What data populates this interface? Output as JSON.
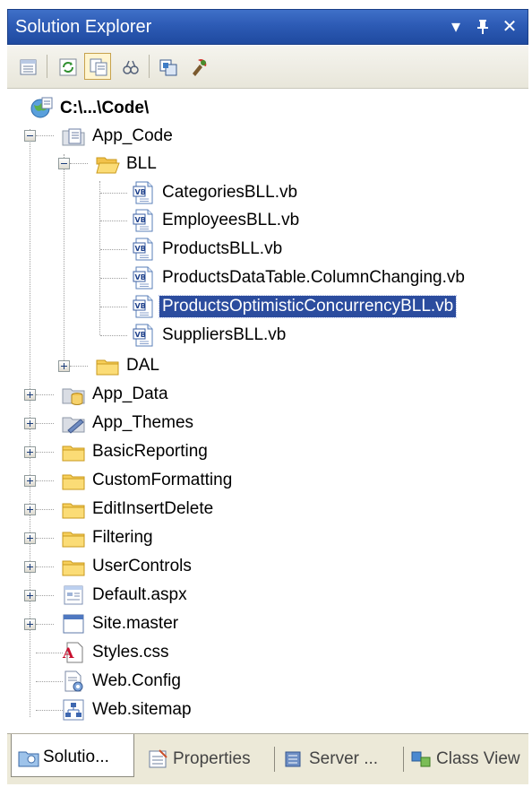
{
  "window": {
    "title": "Solution Explorer",
    "dropdown_glyph": "▾",
    "pin_glyph": "ⵃ",
    "close_glyph": "✕"
  },
  "toolbar": {
    "buttons": [
      {
        "icon": "properties-icon"
      },
      {
        "icon": "refresh-icon"
      },
      {
        "icon": "show-all-files-icon",
        "pressed": true
      },
      {
        "icon": "nest-related-files-icon"
      },
      {
        "icon": "copy-web-site-icon"
      },
      {
        "icon": "asp-net-configuration-icon"
      }
    ]
  },
  "tree": {
    "root": {
      "label": "C:\\...\\Code\\",
      "icon": "web-project-icon"
    },
    "app_code": {
      "label": "App_Code",
      "icon": "special-folder-icon",
      "expanded": true
    },
    "bll": {
      "label": "BLL",
      "icon": "open-folder-icon",
      "expanded": true
    },
    "bll_files": [
      {
        "label": "CategoriesBLL.vb",
        "icon": "vb-file-icon"
      },
      {
        "label": "EmployeesBLL.vb",
        "icon": "vb-file-icon"
      },
      {
        "label": "ProductsBLL.vb",
        "icon": "vb-file-icon"
      },
      {
        "label": "ProductsDataTable.ColumnChanging.vb",
        "icon": "vb-file-icon"
      },
      {
        "label": "ProductsOptimisticConcurrencyBLL.vb",
        "icon": "vb-file-icon",
        "selected": true
      },
      {
        "label": "SuppliersBLL.vb",
        "icon": "vb-file-icon"
      }
    ],
    "dal": {
      "label": "DAL",
      "icon": "folder-icon",
      "expanded": false
    },
    "items": [
      {
        "label": "App_Data",
        "icon": "app-data-folder-icon",
        "expandable": true
      },
      {
        "label": "App_Themes",
        "icon": "app-themes-folder-icon",
        "expandable": true
      },
      {
        "label": "BasicReporting",
        "icon": "folder-icon",
        "expandable": true
      },
      {
        "label": "CustomFormatting",
        "icon": "folder-icon",
        "expandable": true
      },
      {
        "label": "EditInsertDelete",
        "icon": "folder-icon",
        "expandable": true
      },
      {
        "label": "Filtering",
        "icon": "folder-icon",
        "expandable": true
      },
      {
        "label": "UserControls",
        "icon": "folder-icon",
        "expandable": true
      },
      {
        "label": "Default.aspx",
        "icon": "aspx-file-icon",
        "expandable": true
      },
      {
        "label": "Site.master",
        "icon": "master-page-icon",
        "expandable": true
      },
      {
        "label": "Styles.css",
        "icon": "css-file-icon",
        "expandable": false
      },
      {
        "label": "Web.Config",
        "icon": "config-file-icon",
        "expandable": false
      },
      {
        "label": "Web.sitemap",
        "icon": "sitemap-file-icon",
        "expandable": false
      }
    ]
  },
  "bottom_tabs": [
    {
      "label": "Solutio...",
      "icon": "solution-explorer-icon",
      "active": true
    },
    {
      "label": "Properties",
      "icon": "properties-window-icon",
      "active": false
    },
    {
      "label": "Server ...",
      "icon": "server-explorer-icon",
      "active": false
    },
    {
      "label": "Class View",
      "icon": "class-view-icon",
      "active": false
    }
  ],
  "colors": {
    "title_bar": "#2d5bb5",
    "selection": "#2b4c9e",
    "folder": "#f4c64a"
  }
}
